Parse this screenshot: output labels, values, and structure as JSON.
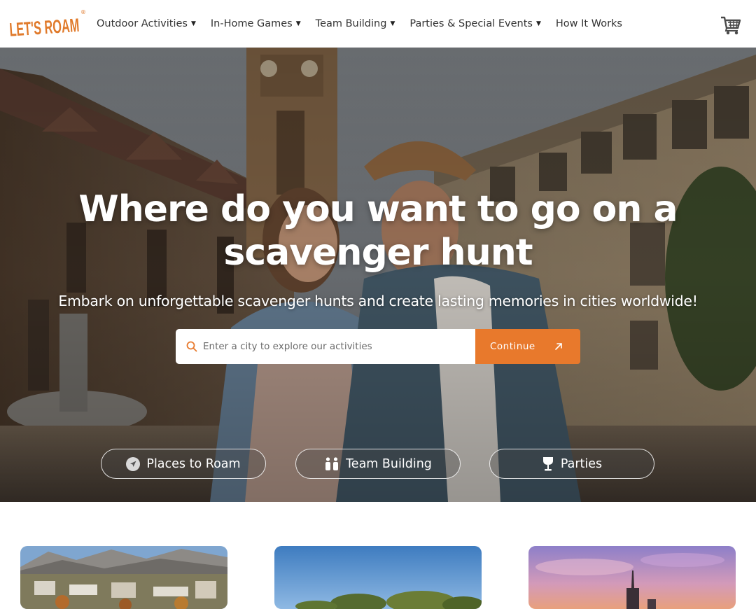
{
  "header": {
    "logo_text": "LET'S ROAM",
    "logo_mark": "®",
    "nav": [
      {
        "label": "Outdoor Activities",
        "has_dropdown": true
      },
      {
        "label": "In-Home Games",
        "has_dropdown": true
      },
      {
        "label": "Team Building",
        "has_dropdown": true
      },
      {
        "label": "Parties & Special Events",
        "has_dropdown": true
      },
      {
        "label": "How It Works",
        "has_dropdown": false
      }
    ],
    "caret": "▼",
    "cart_icon": "shopping-cart-icon"
  },
  "hero": {
    "title": "Where do you want to go on a scavenger hunt",
    "subtitle": "Embark on unforgettable scavenger hunts and create lasting memories in cities worldwide!",
    "search": {
      "placeholder": "Enter a city to explore our activities",
      "value": "",
      "icon": "search-icon",
      "button_label": "Continue",
      "button_icon": "arrow-up-right-icon"
    },
    "pills": [
      {
        "label": "Places to Roam",
        "icon": "navigation-icon"
      },
      {
        "label": "Team Building",
        "icon": "people-icon"
      },
      {
        "label": "Parties",
        "icon": "wine-glass-icon"
      }
    ]
  },
  "cards": [
    {
      "name": "mountain-city-card"
    },
    {
      "name": "park-card"
    },
    {
      "name": "skyline-sunset-card"
    }
  ],
  "colors": {
    "brand_orange": "#e8792c",
    "logo_orange": "#e07a2b",
    "nav_text": "#333333"
  }
}
